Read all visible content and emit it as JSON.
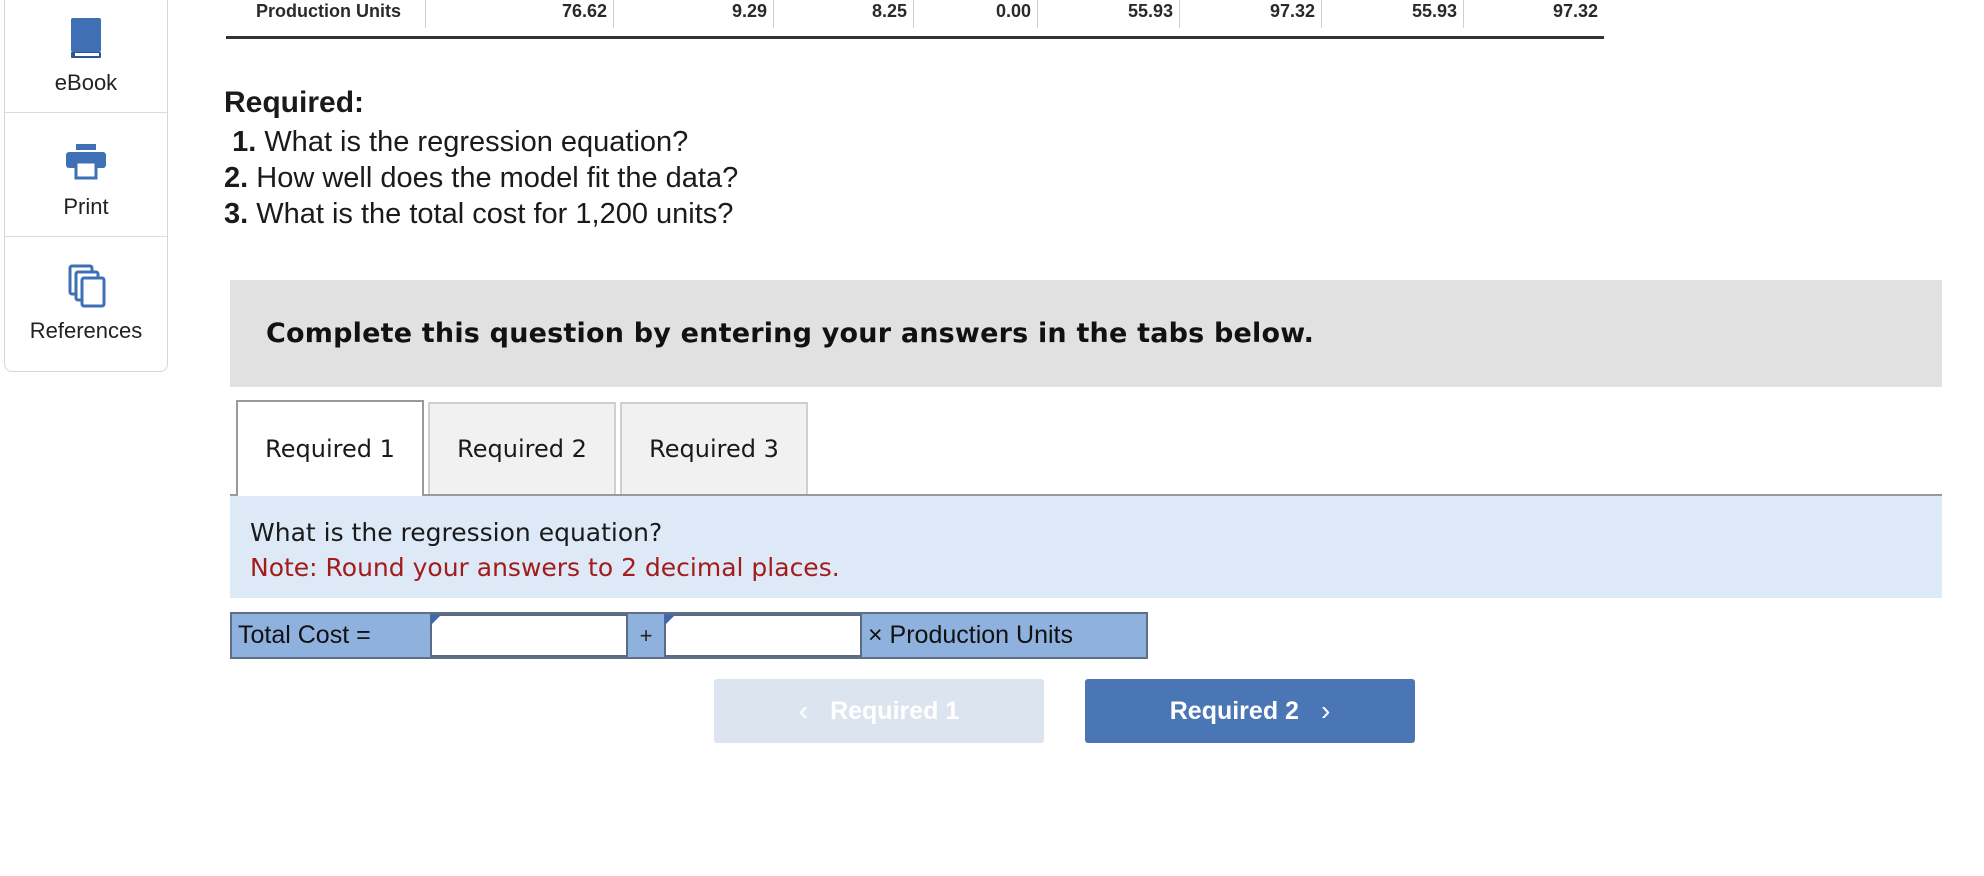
{
  "sidebar": {
    "items": [
      {
        "label": "eBook",
        "icon": "book-icon"
      },
      {
        "label": "Print",
        "icon": "printer-icon"
      },
      {
        "label": "References",
        "icon": "copy-icon"
      }
    ]
  },
  "data_table": {
    "row_label": "Production Units",
    "values": [
      "76.62",
      "9.29",
      "8.25",
      "0.00",
      "55.93",
      "97.32",
      "55.93",
      "97.32"
    ]
  },
  "required": {
    "title": "Required:",
    "items": [
      {
        "num": "1.",
        "text": "What is the regression equation?"
      },
      {
        "num": "2.",
        "text": "How well does the model fit the data?"
      },
      {
        "num": "3.",
        "text": "What is the total cost for 1,200 units?"
      }
    ]
  },
  "banner": {
    "text": "Complete this question by entering your answers in the tabs below."
  },
  "tabs": [
    {
      "label": "Required 1",
      "active": true
    },
    {
      "label": "Required 2",
      "active": false
    },
    {
      "label": "Required 3",
      "active": false
    }
  ],
  "question": {
    "text": "What is the regression equation?",
    "note": "Note: Round your answers to 2 decimal places."
  },
  "equation": {
    "label": "Total Cost =",
    "intercept_value": "",
    "plus": "+",
    "slope_value": "",
    "unit_label": "× Production Units"
  },
  "navigation": {
    "prev_label": "Required 1",
    "next_label": "Required 2",
    "prev_chevron": "‹",
    "next_chevron": "›"
  },
  "colors": {
    "accent_blue": "#4a76b6",
    "note_red": "#a31b1b",
    "panel_blue": "#dde9f6",
    "equation_blue": "#8fb1de"
  }
}
